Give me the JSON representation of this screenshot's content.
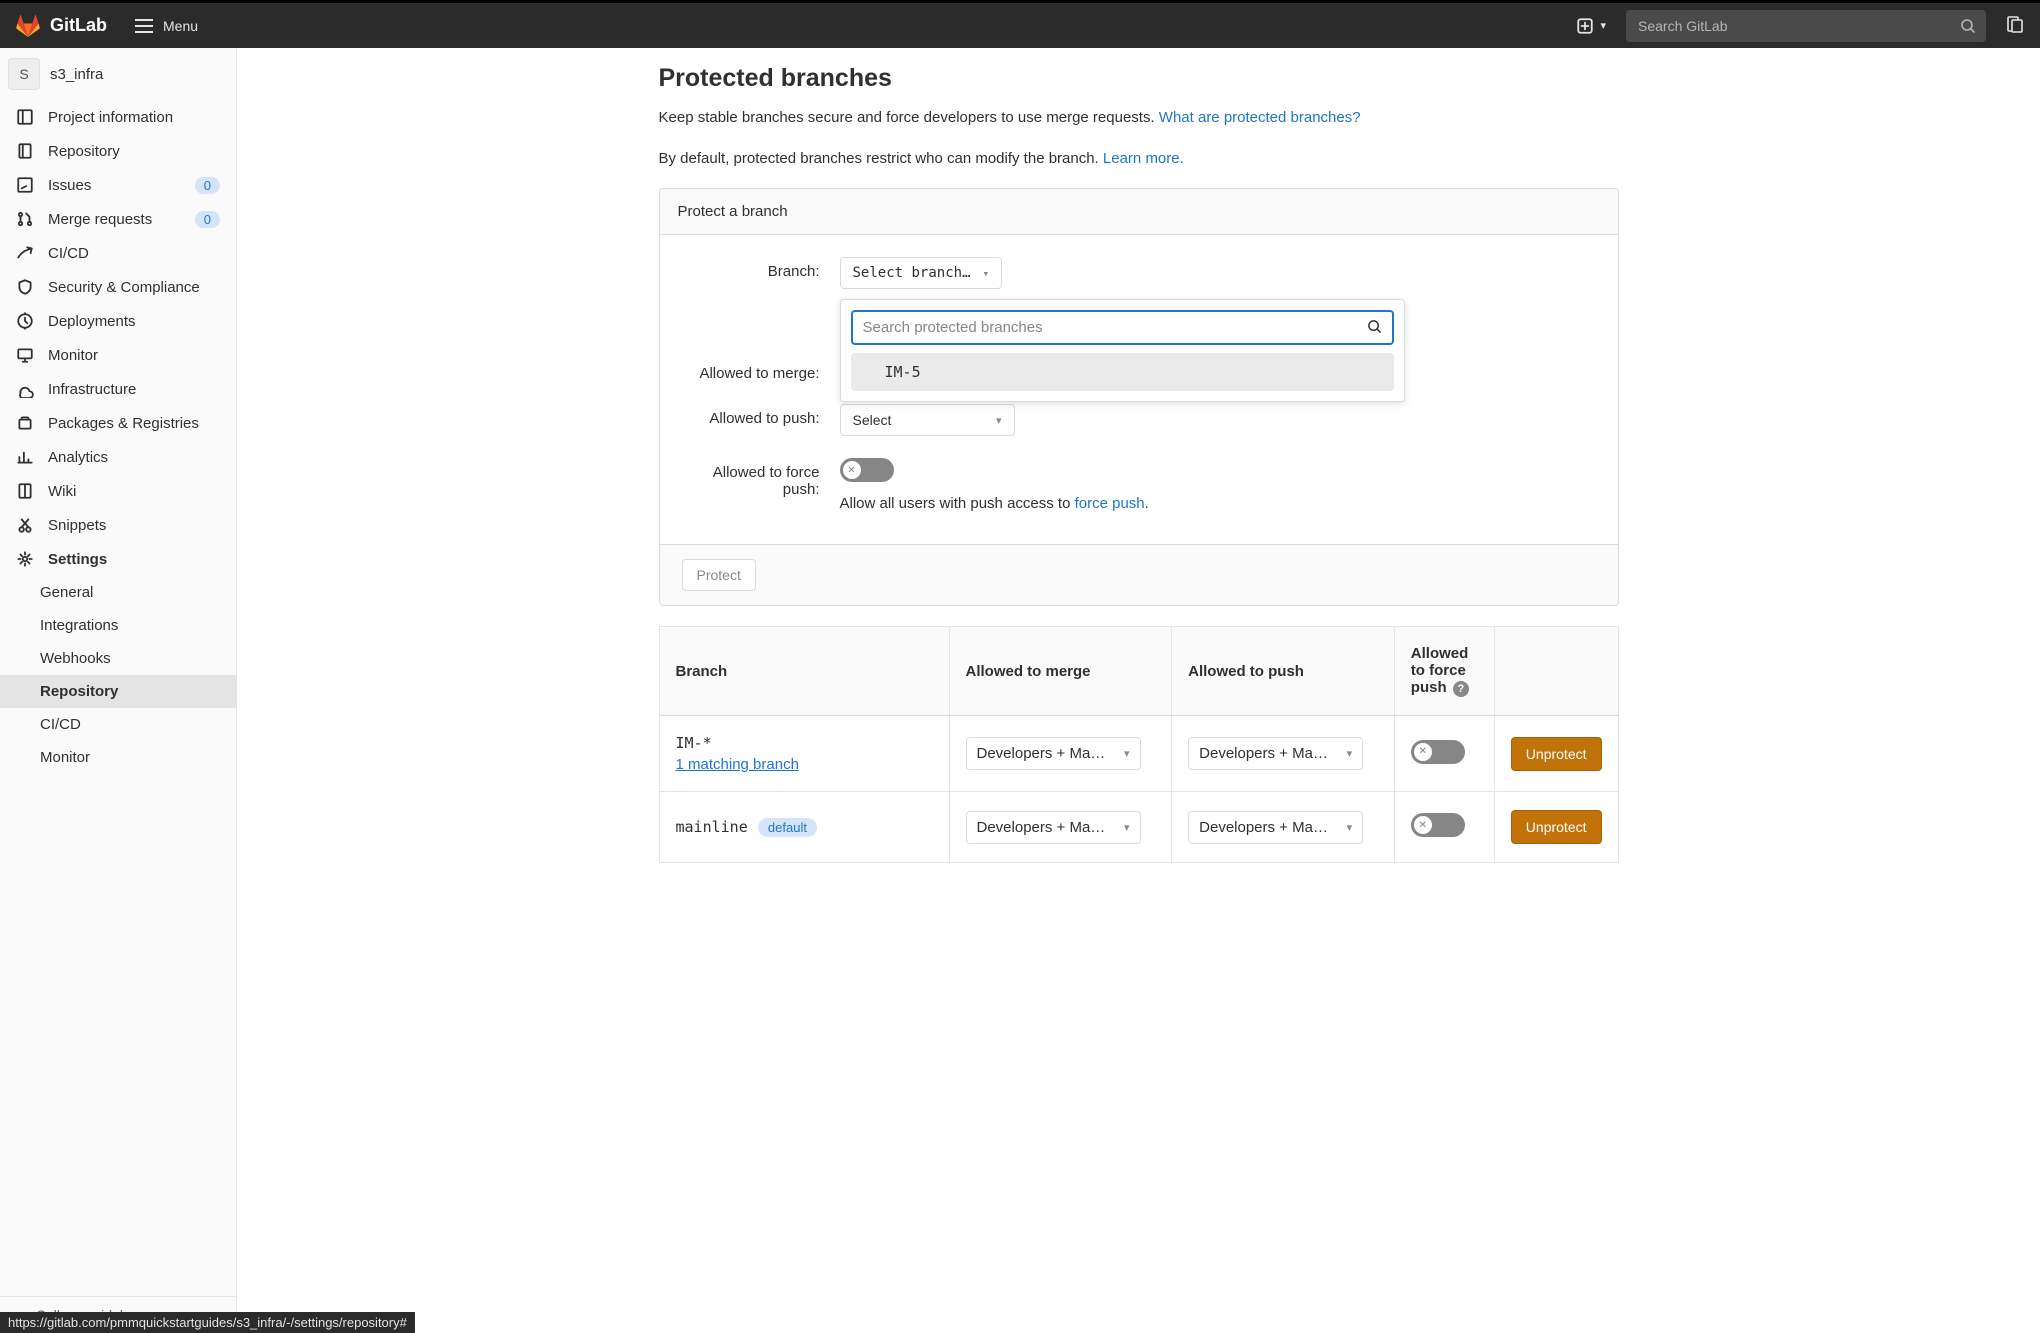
{
  "topnav": {
    "product": "GitLab",
    "menu_label": "Menu",
    "search_placeholder": "Search GitLab"
  },
  "sidebar": {
    "project_letter": "S",
    "project_name": "s3_infra",
    "items": [
      {
        "label": "Project information"
      },
      {
        "label": "Repository"
      },
      {
        "label": "Issues",
        "badge": "0"
      },
      {
        "label": "Merge requests",
        "badge": "0"
      },
      {
        "label": "CI/CD"
      },
      {
        "label": "Security & Compliance"
      },
      {
        "label": "Deployments"
      },
      {
        "label": "Monitor"
      },
      {
        "label": "Infrastructure"
      },
      {
        "label": "Packages & Registries"
      },
      {
        "label": "Analytics"
      },
      {
        "label": "Wiki"
      },
      {
        "label": "Snippets"
      },
      {
        "label": "Settings"
      }
    ],
    "settings_sub": [
      {
        "label": "General"
      },
      {
        "label": "Integrations"
      },
      {
        "label": "Webhooks"
      },
      {
        "label": "Repository"
      },
      {
        "label": "CI/CD"
      },
      {
        "label": "Monitor"
      }
    ],
    "collapse_label": "Collapse sidebar"
  },
  "page": {
    "title": "Protected branches",
    "desc1_pre": "Keep stable branches secure and force developers to use merge requests. ",
    "desc1_link": "What are protected branches?",
    "desc2_pre": "By default, protected branches restrict who can modify the branch. ",
    "desc2_link": "Learn more."
  },
  "form": {
    "panel_title": "Protect a branch",
    "branch_label": "Branch:",
    "branch_select_text": "Select branch…",
    "dropdown_search_placeholder": "Search protected branches",
    "dropdown_option": "IM-5",
    "merge_label": "Allowed to merge:",
    "push_label": "Allowed to push:",
    "push_select_text": "Select",
    "force_label": "Allowed to force push:",
    "force_help_pre": "Allow all users with push access to ",
    "force_help_link": "force push",
    "force_help_post": ".",
    "protect_btn": "Protect"
  },
  "table": {
    "headers": {
      "branch": "Branch",
      "merge": "Allowed to merge",
      "push": "Allowed to push",
      "force": "Allowed to force push"
    },
    "rows": [
      {
        "name": "IM-*",
        "sublink": "1 matching branch",
        "merge": "Developers + Ma…",
        "push": "Developers + Ma…",
        "action": "Unprotect"
      },
      {
        "name": "mainline",
        "pill": "default",
        "merge": "Developers + Ma…",
        "push": "Developers + Ma…",
        "action": "Unprotect"
      }
    ]
  },
  "status_url": "https://gitlab.com/pmmquickstartguides/s3_infra/-/settings/repository#"
}
